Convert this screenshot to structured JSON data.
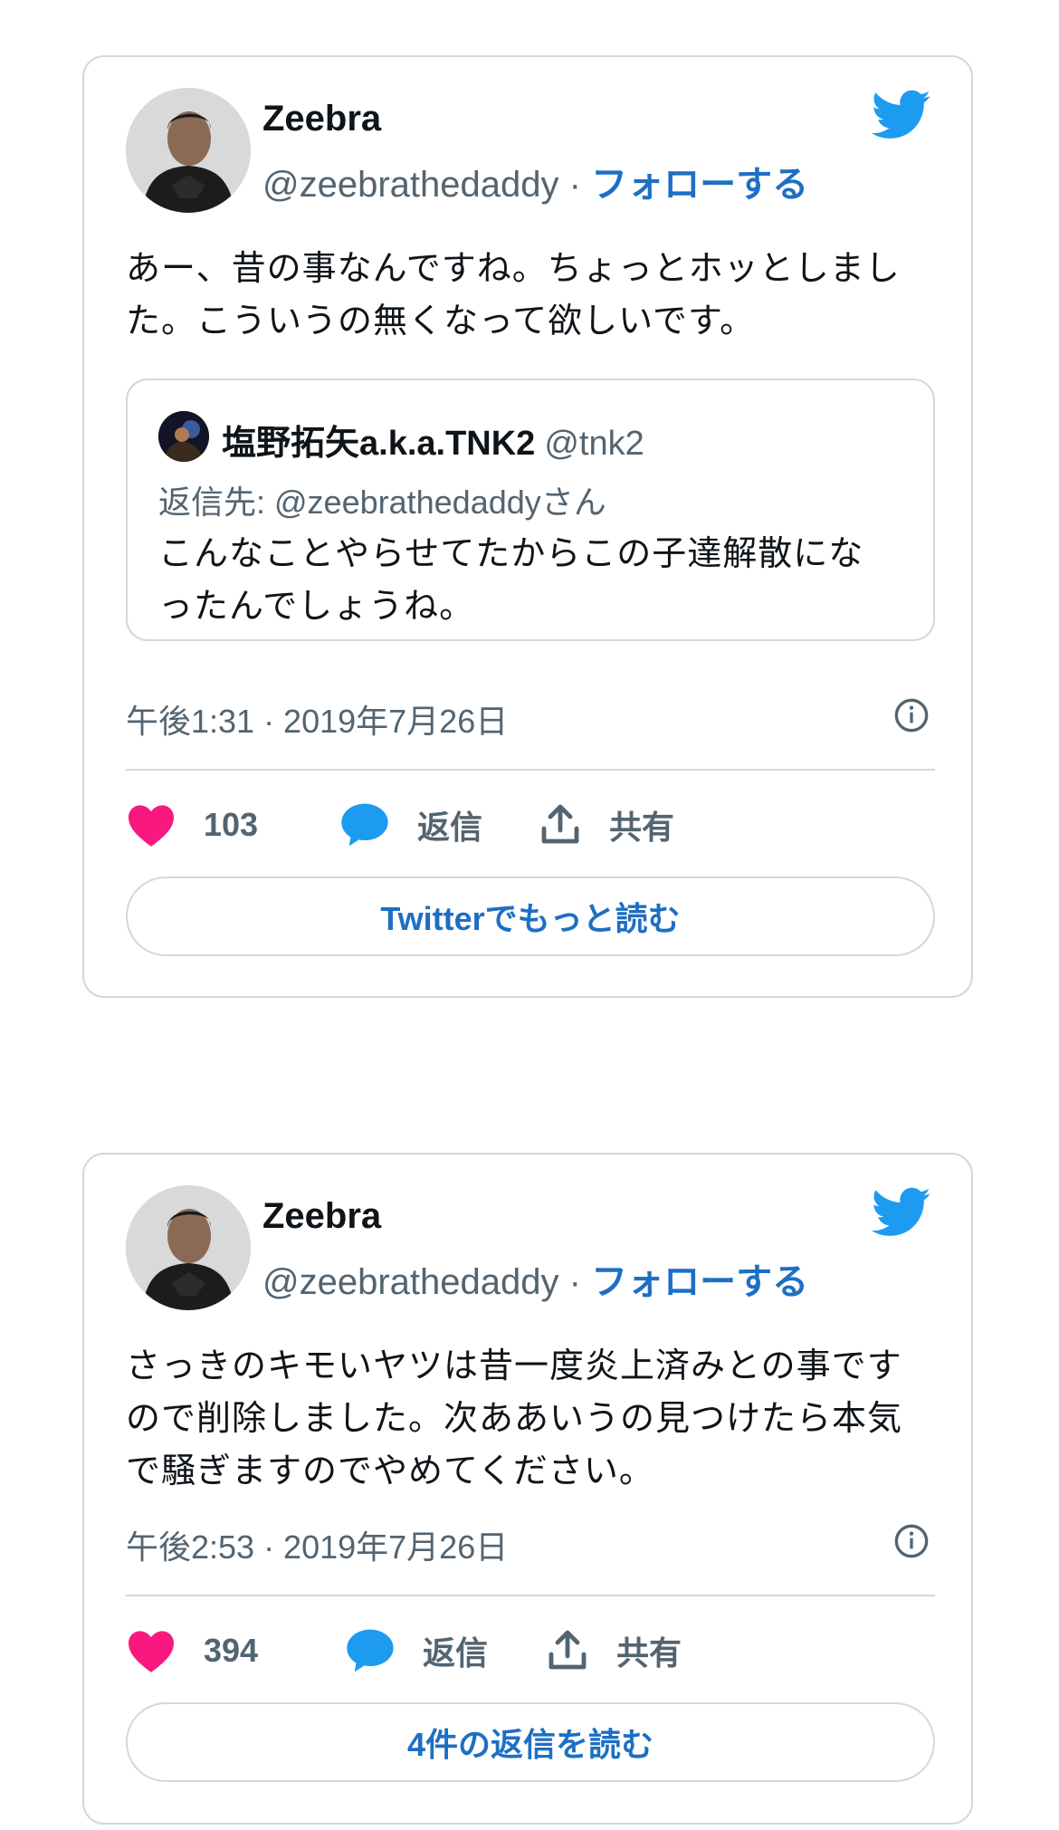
{
  "colors": {
    "twitter_blue": "#1d9bf0",
    "link_blue": "#1d6fc4",
    "heart_pink": "#f91880",
    "text_primary": "#0f1419",
    "text_secondary": "#536471",
    "border": "#cfd9de"
  },
  "tweets": [
    {
      "author_name": "Zeebra",
      "author_handle": "@zeebrathedaddy",
      "separator": "·",
      "follow_label": "フォローする",
      "text_line1": "あー、昔の事なんですね。ちょっとホッとしまし",
      "text_line2": "た。こういうの無くなって欲しいです。",
      "quote": {
        "author_name": "塩野拓矢a.k.a.TNK2",
        "author_handle": "@tnk2",
        "reply_to": "返信先: @zeebrathedaddyさん",
        "text_line1": "こんなことやらせてたからこの子達解散にな",
        "text_line2": "ったんでしょうね。"
      },
      "timestamp": "午後1:31 · 2019年7月26日",
      "likes": "103",
      "reply_label": "返信",
      "share_label": "共有",
      "cta_label": "Twitterでもっと読む",
      "icons": [
        "bird-icon",
        "info-icon",
        "heart-icon",
        "reply-bubble-icon",
        "share-icon"
      ]
    },
    {
      "author_name": "Zeebra",
      "author_handle": "@zeebrathedaddy",
      "separator": "·",
      "follow_label": "フォローする",
      "text_line1": "さっきのキモいヤツは昔一度炎上済みとの事です",
      "text_line2": "ので削除しました。次ああいうの見つけたら本気",
      "text_line3": "で騒ぎますのでやめてください。",
      "timestamp": "午後2:53 · 2019年7月26日",
      "likes": "394",
      "reply_label": "返信",
      "share_label": "共有",
      "cta_label": "4件の返信を読む",
      "icons": [
        "bird-icon",
        "info-icon",
        "heart-icon",
        "reply-bubble-icon",
        "share-icon"
      ]
    }
  ]
}
